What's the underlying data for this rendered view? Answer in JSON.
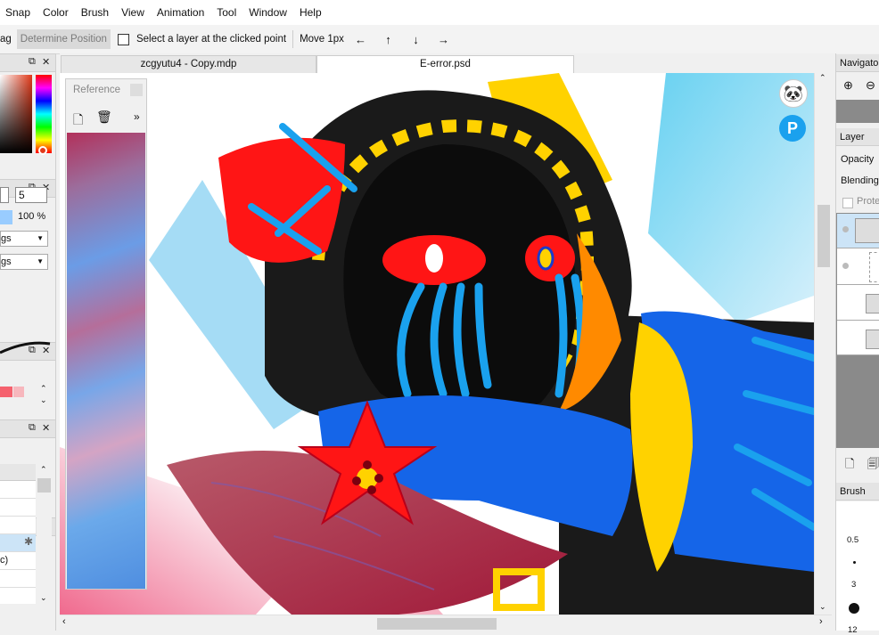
{
  "menu": [
    "Snap",
    "Color",
    "Brush",
    "View",
    "Animation",
    "Tool",
    "Window",
    "Help"
  ],
  "toolbar": {
    "partial_label": "ag",
    "determine_position": "Determine Position",
    "select_layer_label": "Select a layer at the clicked point",
    "move_label": "Move 1px",
    "arrows": [
      "←",
      "↑",
      "↓",
      "→"
    ]
  },
  "tabs": [
    {
      "label": "zcgyutu4 - Copy.mdp",
      "active": false
    },
    {
      "label": "E-error.psd",
      "active": true
    }
  ],
  "left": {
    "brush_size_value": "5",
    "opacity_value": "100 %",
    "dropdown1": "gs",
    "dropdown2": "gs",
    "layer_row_partial": "c)"
  },
  "reference": {
    "title": "Reference"
  },
  "right": {
    "navigator_title": "Navigator",
    "layer_title": "Layer",
    "opacity_label": "Opacity",
    "blending_label": "Blending",
    "protect_label": "Prote",
    "brush_size_title": "Brush Size",
    "brush_sizes": [
      "0.5",
      "3",
      "12"
    ]
  },
  "colors": {
    "accent_blue": "#99ccff",
    "selected_row": "#cce4f7"
  }
}
